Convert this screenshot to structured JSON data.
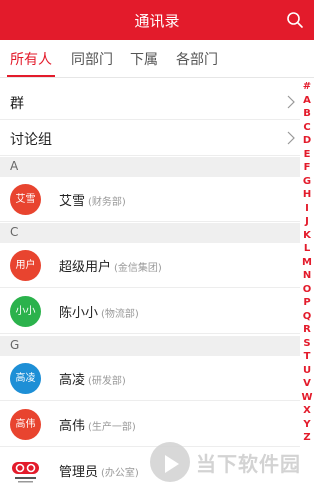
{
  "header": {
    "title": "通讯录",
    "search_icon": "search-icon"
  },
  "tabs": [
    {
      "label": "所有人",
      "active": true
    },
    {
      "label": "同部门",
      "active": false
    },
    {
      "label": "下属",
      "active": false
    },
    {
      "label": "各部门",
      "active": false
    }
  ],
  "rows": [
    {
      "label": "群"
    },
    {
      "label": "讨论组"
    }
  ],
  "sections": {
    "a": "A",
    "c": "C",
    "g": "G"
  },
  "contacts": [
    {
      "avatar_text": "艾雪",
      "name": "艾雪",
      "dept": "(财务部)",
      "color": "#e8442f"
    },
    {
      "avatar_text": "用户",
      "name": "超级用户",
      "dept": "(金信集团)",
      "color": "#e8442f"
    },
    {
      "avatar_text": "小小",
      "name": "陈小小",
      "dept": "(物流部)",
      "color": "#2bb24c"
    },
    {
      "avatar_text": "高凌",
      "name": "高凌",
      "dept": "(研发部)",
      "color": "#1e8fd6"
    },
    {
      "avatar_text": "高伟",
      "name": "高伟",
      "dept": "(生产一部)",
      "color": "#e8442f"
    },
    {
      "avatar_text": "",
      "name": "管理员",
      "dept": "(办公室)",
      "color": "#e31b2b"
    }
  ],
  "index_letters": [
    "#",
    "A",
    "B",
    "C",
    "D",
    "E",
    "F",
    "G",
    "H",
    "I",
    "J",
    "K",
    "L",
    "M",
    "N",
    "O",
    "P",
    "Q",
    "R",
    "S",
    "T",
    "U",
    "V",
    "W",
    "X",
    "Y",
    "Z"
  ],
  "watermark": {
    "text": "当下软件园"
  },
  "colors": {
    "brand": "#e31b2b"
  }
}
